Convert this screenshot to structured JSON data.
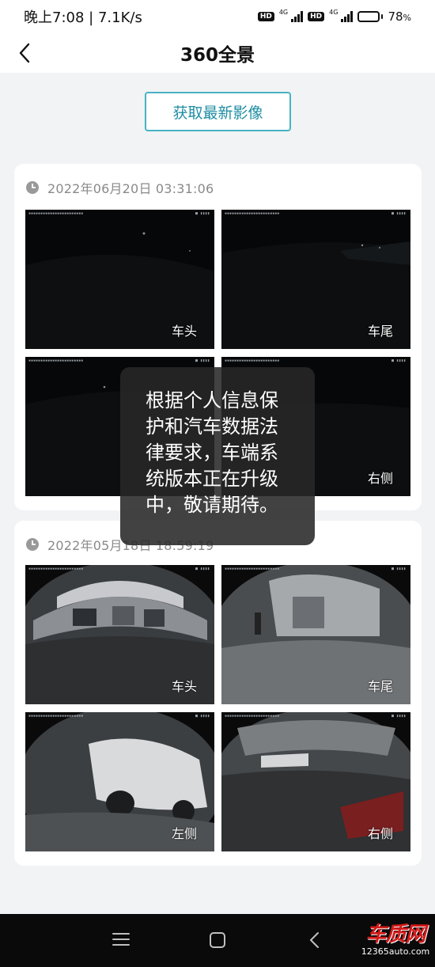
{
  "status_bar": {
    "time": "晚上7:08",
    "speed": "7.1K/s",
    "hd_badge": "HD",
    "network_type": "4G",
    "battery_percent": "78",
    "battery_unit": "%",
    "battery_level": 0.78
  },
  "header": {
    "back_icon": "chevron-left-icon",
    "title": "360全景"
  },
  "fetch_button_label": "获取最新影像",
  "records": [
    {
      "time": "2022年06月20日 03:31:06",
      "views": [
        {
          "label": "车头"
        },
        {
          "label": "车尾"
        },
        {
          "label": ""
        },
        {
          "label": "右侧"
        }
      ]
    },
    {
      "time": "2022年05月18日 18:59:19",
      "views": [
        {
          "label": "车头"
        },
        {
          "label": "车尾"
        },
        {
          "label": "左侧"
        },
        {
          "label": "右侧"
        }
      ]
    }
  ],
  "toast": {
    "lines": [
      "根据个人信息保",
      "护和汽车数据法",
      "律要求，车端系",
      "统版本正在升级",
      "中，敬请期待。"
    ]
  },
  "system_nav": {
    "menu_icon": "menu-icon",
    "home_icon": "square-home-icon",
    "back_icon": "triangle-back-icon"
  },
  "watermark": {
    "main": "车质网",
    "sub": "12365auto.com"
  },
  "colors": {
    "accent": "#48b3c3",
    "accent_text": "#1f8ea3",
    "page_bg": "#f1f3f5",
    "watermark_red": "#d41919"
  }
}
